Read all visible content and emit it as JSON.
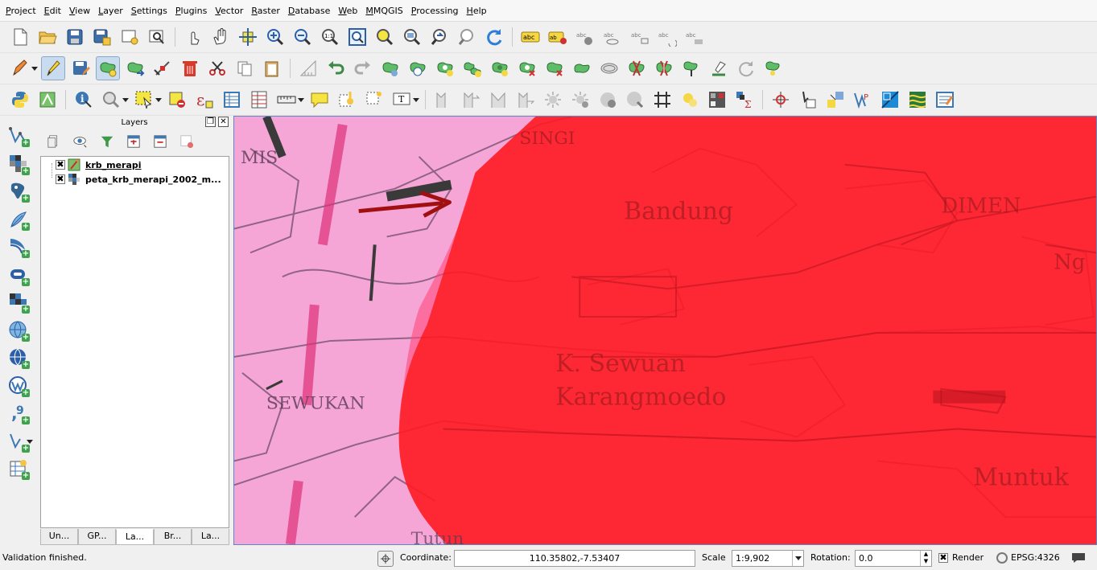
{
  "menu": [
    "Project",
    "Edit",
    "View",
    "Layer",
    "Settings",
    "Plugins",
    "Vector",
    "Raster",
    "Database",
    "Web",
    "MMQGIS",
    "Processing",
    "Help"
  ],
  "toolbar1": [
    "new-project-icon",
    "open-project-icon",
    "save-project-icon",
    "save-as-icon",
    "new-print-composer-icon",
    "composer-manager-icon",
    "touch-zoom-icon",
    "pan-icon",
    "pan-to-selection-icon",
    "zoom-in-icon",
    "zoom-out-icon",
    "zoom-native-icon",
    "zoom-full-icon",
    "zoom-to-selection-icon",
    "zoom-to-layer-icon",
    "zoom-last-icon",
    "zoom-next-icon",
    "refresh-icon",
    "layer-labeling-icon",
    "label-pin-icon",
    "label-highlight-icon",
    "label-show-hide-icon",
    "label-move-icon",
    "label-rotate-icon",
    "label-change-icon"
  ],
  "toolbar2": [
    "current-edits-icon",
    "toggle-editing-icon",
    "save-layer-edits-icon",
    "add-feature-icon",
    "move-feature-icon",
    "node-tool-icon",
    "delete-selected-icon",
    "cut-features-icon",
    "copy-features-icon",
    "paste-features-icon",
    "snapping-icon",
    "undo-icon",
    "redo-icon",
    "rotate-feature-icon",
    "simplify-icon",
    "add-ring-icon",
    "add-part-icon",
    "fill-ring-icon",
    "delete-ring-icon",
    "delete-part-icon",
    "reshape-icon",
    "offset-curve-icon",
    "split-features-icon",
    "split-parts-icon",
    "merge-features-icon",
    "merge-attributes-icon",
    "rotate-point-icon",
    "offset-point-icon"
  ],
  "toolbar3": [
    "python-console-icon",
    "processing-icon",
    "identify-icon",
    "select-by-value-icon",
    "select-features-icon",
    "deselect-icon",
    "expression-select-icon",
    "attribute-table-icon",
    "field-calculator-icon",
    "measure-icon",
    "map-tips-icon",
    "new-bookmark-icon",
    "text-annotation-icon",
    "spatial-query-1-icon",
    "spatial-query-2-icon",
    "spatial-query-3-icon",
    "spatial-query-4-icon",
    "light-1-icon",
    "light-2-icon",
    "light-3-icon",
    "light-4-icon",
    "grid-icon",
    "point-icon",
    "raster-calc-icon",
    "statistics-icon",
    "coordinate-capture-icon",
    "georeferencer-icon",
    "digitize-icon",
    "vector-plugin-icon",
    "map-swipe-icon",
    "terrain-icon",
    "notes-icon"
  ],
  "left_toolbar": [
    "add-vector-layer-icon",
    "add-raster-layer-icon",
    "add-postgis-layer-icon",
    "add-spatialite-layer-icon",
    "add-mssql-layer-icon",
    "add-oracle-layer-icon",
    "add-wms-layer-icon",
    "add-wcs-layer-icon",
    "add-wfs-layer-icon",
    "add-delimited-text-layer-icon",
    "new-shapefile-layer-icon",
    "add-virtual-layer-icon"
  ],
  "layers_panel": {
    "title": "Layers",
    "layers": [
      {
        "name": "krb_merapi",
        "checked": "✖",
        "current": true
      },
      {
        "name": "peta_krb_merapi_2002_m...",
        "checked": "✖",
        "current": false
      }
    ],
    "tabs": [
      "Un...",
      "GP...",
      "La...",
      "Br...",
      "La..."
    ],
    "active_tab": 2
  },
  "map": {
    "labels": [
      "MIS",
      "SINGI",
      "Bandung",
      "DIMEN",
      "Ng",
      "K. Sewuan",
      "Karangmoedo",
      "SEWUKAN",
      "Muntuk",
      "Tutun"
    ],
    "colors": {
      "basemap": "#f6a6d6",
      "polygon": "#ff1a22",
      "arrow": "#a01010"
    }
  },
  "status": {
    "message": "Validation finished.",
    "coordinate_label": "Coordinate:",
    "coordinate": "110.35802,-7.53407",
    "scale_label": "Scale",
    "scale": "1:9,902",
    "rotation_label": "Rotation:",
    "rotation": "0.0",
    "render_label": "Render",
    "render_checked": "✖",
    "crs": "EPSG:4326"
  }
}
